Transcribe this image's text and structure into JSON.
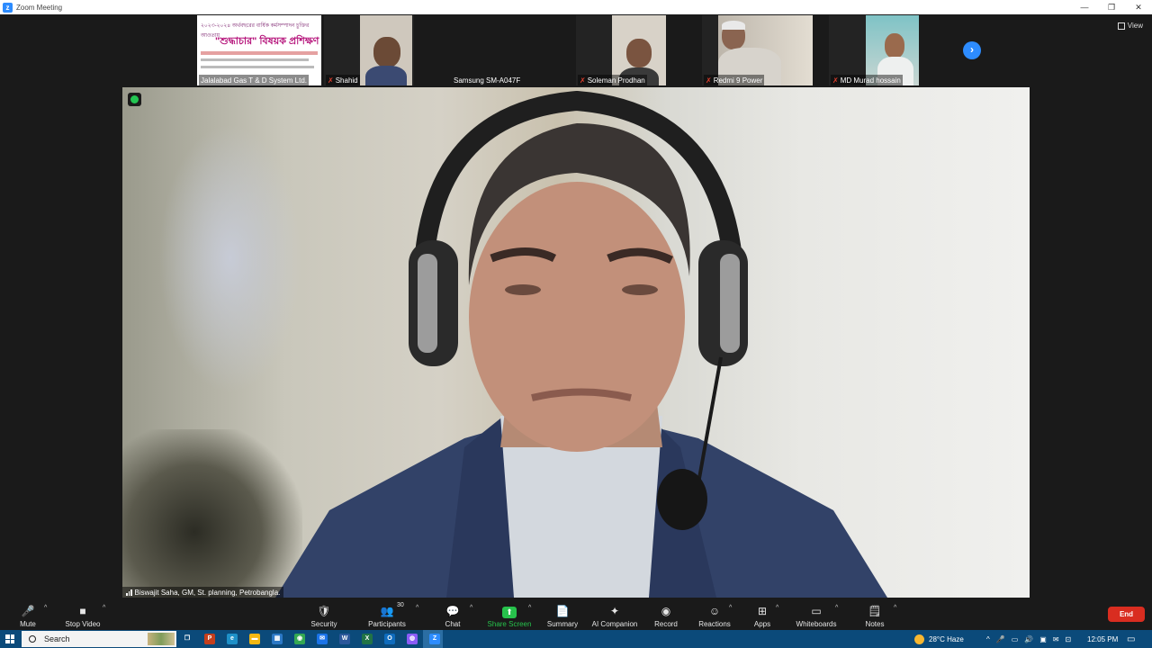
{
  "window": {
    "title": "Zoom Meeting",
    "controls": [
      "—",
      "❐",
      "✕"
    ]
  },
  "view_button": {
    "label": "View"
  },
  "gallery": [
    {
      "label": "Jalalabad Gas T & D System Ltd.",
      "muted": false,
      "kind": "poster",
      "poster_lines": [
        "২০২৩-২০২৪ অর্থবছরের বার্ষিক কর্মসম্পাদন চুক্তির আওতায়",
        "\"শুদ্ধাচার\" বিষয়ক প্রশিক্ষণ"
      ]
    },
    {
      "label": "Shahid",
      "muted": true,
      "kind": "person"
    },
    {
      "label": "Samsung SM-A047F",
      "muted": false,
      "kind": "none"
    },
    {
      "label": "Soleman Prodhan",
      "muted": true,
      "kind": "person"
    },
    {
      "label": "Redmi 9 Power",
      "muted": true,
      "kind": "person"
    },
    {
      "label": "MD Murad  hossain",
      "muted": true,
      "kind": "person"
    }
  ],
  "gallery_next_icon": "›",
  "main_video": {
    "speaker_label": "Biswajit Saha, GM, St. planning, Petrobangla."
  },
  "toolbar": {
    "mute": {
      "label": "Mute",
      "icon": "🎤"
    },
    "stop_video": {
      "label": "Stop Video",
      "icon": "■"
    },
    "security": {
      "label": "Security",
      "icon": "🛡"
    },
    "participants": {
      "label": "Participants",
      "icon": "👥",
      "count": "30"
    },
    "chat": {
      "label": "Chat",
      "icon": "💬"
    },
    "share_screen": {
      "label": "Share Screen",
      "icon": "⬆"
    },
    "summary": {
      "label": "Summary",
      "icon": "📄"
    },
    "ai_companion": {
      "label": "AI Companion",
      "icon": "✦"
    },
    "record": {
      "label": "Record",
      "icon": "◉"
    },
    "reactions": {
      "label": "Reactions",
      "icon": "☺"
    },
    "apps": {
      "label": "Apps",
      "icon": "⊞"
    },
    "whiteboards": {
      "label": "Whiteboards",
      "icon": "▭"
    },
    "notes": {
      "label": "Notes",
      "icon": "🗒"
    },
    "end": {
      "label": "End"
    }
  },
  "taskbar": {
    "search_placeholder": "Search",
    "weather": "28°C  Haze",
    "time": "12:05 PM",
    "app_icons": [
      {
        "name": "task-view",
        "glyph": "❐",
        "color": "#0b4a7a"
      },
      {
        "name": "powerpoint",
        "glyph": "P",
        "color": "#c43e1c"
      },
      {
        "name": "edge",
        "glyph": "e",
        "color": "#1e90c8"
      },
      {
        "name": "file-explorer",
        "glyph": "▬",
        "color": "#f3b712"
      },
      {
        "name": "microsoft-store",
        "glyph": "▦",
        "color": "#2b78c5"
      },
      {
        "name": "chrome",
        "glyph": "◉",
        "color": "#34a853"
      },
      {
        "name": "mail",
        "glyph": "✉",
        "color": "#1a73e8"
      },
      {
        "name": "word",
        "glyph": "W",
        "color": "#2b579a"
      },
      {
        "name": "excel",
        "glyph": "X",
        "color": "#217346"
      },
      {
        "name": "outlook",
        "glyph": "O",
        "color": "#0f6cbd"
      },
      {
        "name": "copilot",
        "glyph": "◍",
        "color": "#8a5cf6"
      },
      {
        "name": "zoom",
        "glyph": "Z",
        "color": "#2D8CFF"
      }
    ],
    "tray_icons": [
      "^",
      "🎤",
      "▭",
      "🔊",
      "▣",
      "✉",
      "⊡"
    ]
  }
}
